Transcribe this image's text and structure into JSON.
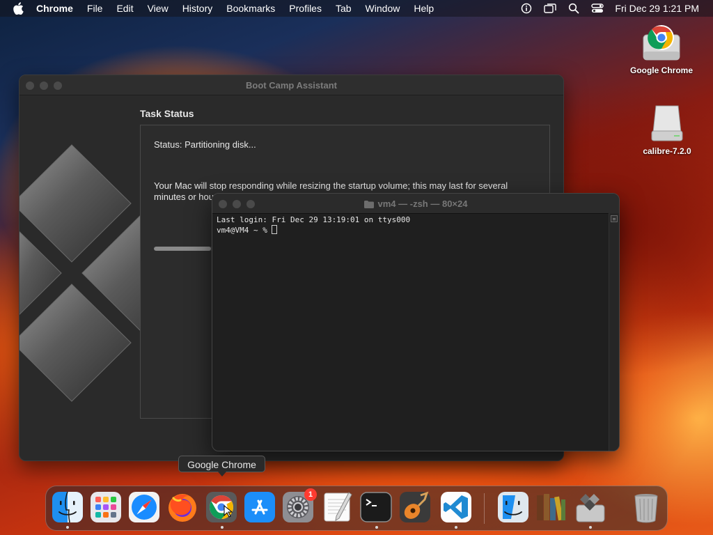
{
  "menubar": {
    "app_name": "Chrome",
    "items": [
      "File",
      "Edit",
      "View",
      "History",
      "Bookmarks",
      "Profiles",
      "Tab",
      "Window",
      "Help"
    ],
    "clock": "Fri Dec 29  1:21 PM"
  },
  "desktop": {
    "icons": [
      {
        "label": "Google Chrome",
        "icon": "chrome-drive-icon"
      },
      {
        "label": "calibre-7.2.0",
        "icon": "disk-image-icon"
      }
    ]
  },
  "bootcamp": {
    "title": "Boot Camp Assistant",
    "task_heading": "Task Status",
    "status": "Status: Partitioning disk...",
    "message": "Your Mac will stop responding while resizing the startup volume; this may last for several minutes or hours. Do not force restart until the process is complete.",
    "progress": 0.15
  },
  "terminal": {
    "title": "vm4 — -zsh — 80×24",
    "line1": "Last login: Fri Dec 29 13:19:01 on ttys000",
    "prompt": "vm4@VM4 ~ % "
  },
  "tooltip": {
    "text": "Google Chrome"
  },
  "dock": {
    "items": [
      {
        "name": "finder",
        "running": true
      },
      {
        "name": "launchpad",
        "running": false
      },
      {
        "name": "safari",
        "running": false
      },
      {
        "name": "firefox",
        "running": false
      },
      {
        "name": "google-chrome",
        "running": true
      },
      {
        "name": "app-store",
        "running": false
      },
      {
        "name": "system-settings",
        "running": false,
        "badge": "1"
      },
      {
        "name": "textedit",
        "running": false
      },
      {
        "name": "terminal",
        "running": true
      },
      {
        "name": "garageband",
        "running": false
      },
      {
        "name": "vscode",
        "running": true
      },
      {
        "name": "finder-2",
        "running": false
      },
      {
        "name": "calibre",
        "running": false
      },
      {
        "name": "boot-camp-assistant",
        "running": true
      },
      {
        "name": "trash",
        "running": false
      }
    ]
  },
  "colors": {
    "accent_red": "#ff3b30",
    "chrome_red": "#db4437",
    "chrome_yellow": "#f4b400",
    "chrome_green": "#0f9d58",
    "chrome_blue": "#4285f4"
  }
}
